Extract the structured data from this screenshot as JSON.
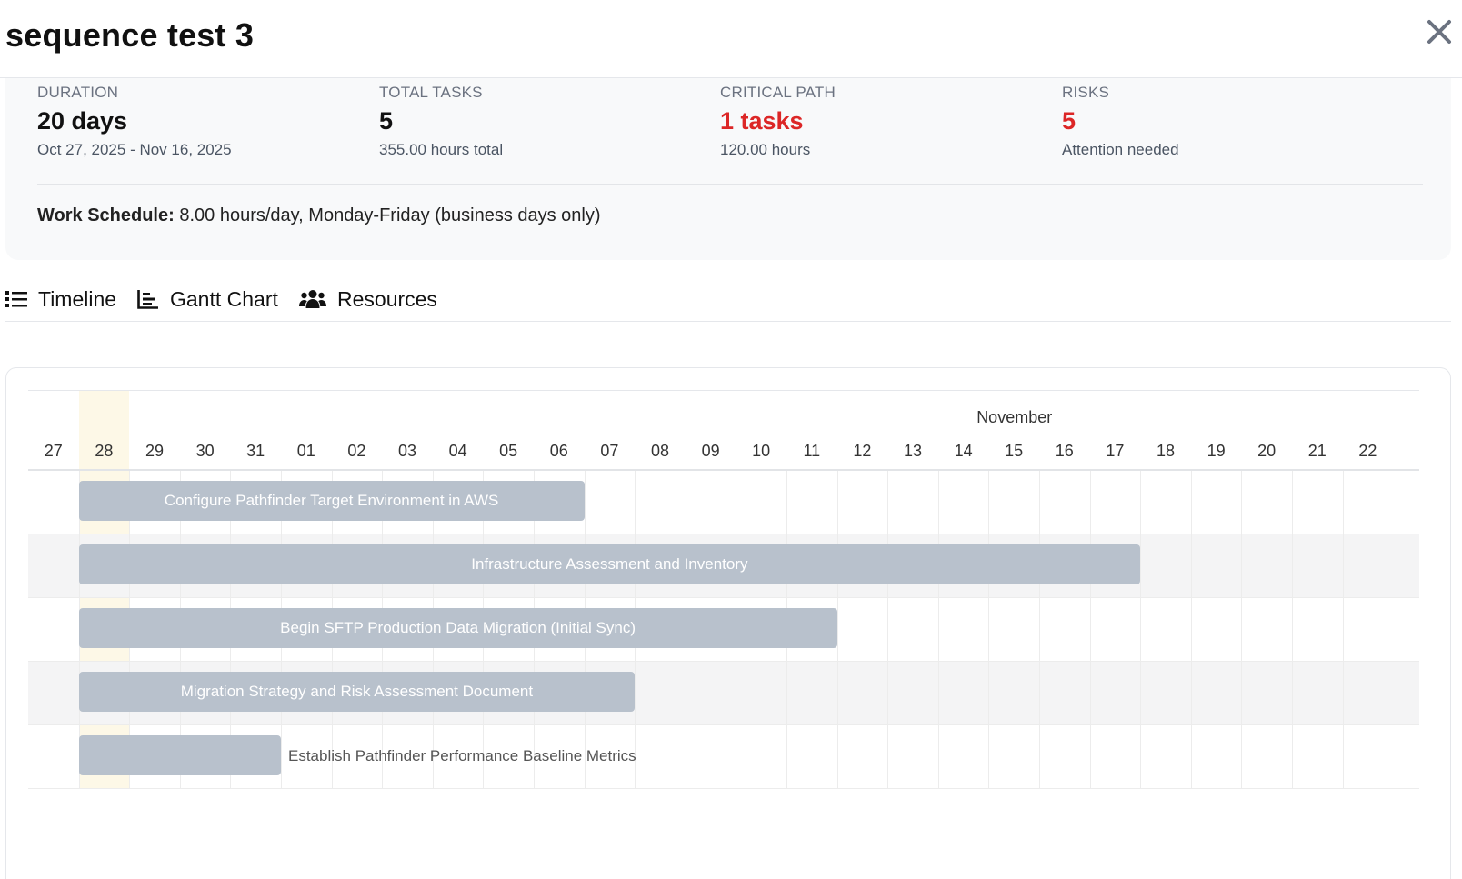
{
  "header": {
    "title": "sequence test 3",
    "close_icon": "close-icon"
  },
  "summary": {
    "duration": {
      "label": "DURATION",
      "value": "20 days",
      "sub": "Oct 27, 2025 - Nov 16, 2025"
    },
    "total_tasks": {
      "label": "TOTAL TASKS",
      "value": "5",
      "sub": "355.00 hours total"
    },
    "critical_path": {
      "label": "CRITICAL PATH",
      "value": "1 tasks",
      "sub": "120.00 hours"
    },
    "risks": {
      "label": "RISKS",
      "value": "5",
      "sub": "Attention needed"
    },
    "schedule_label": "Work Schedule:",
    "schedule_value": " 8.00 hours/day, Monday-Friday (business days only)",
    "alert_color": "#dc2626"
  },
  "tabs": [
    {
      "label": "Timeline",
      "icon": "list-icon"
    },
    {
      "label": "Gantt Chart",
      "icon": "chart-bar-icon"
    },
    {
      "label": "Resources",
      "icon": "users-icon"
    }
  ],
  "gantt": {
    "month_label": "November",
    "days": [
      "27",
      "28",
      "29",
      "30",
      "31",
      "01",
      "02",
      "03",
      "04",
      "05",
      "06",
      "07",
      "08",
      "09",
      "10",
      "11",
      "12",
      "13",
      "14",
      "15",
      "16",
      "17",
      "18",
      "19",
      "20",
      "21",
      "22"
    ],
    "today_index": 1,
    "tasks": [
      {
        "name": "Configure Pathfinder Target Environment in AWS",
        "start": 1,
        "end": 11,
        "label_inside": true
      },
      {
        "name": "Infrastructure Assessment and Inventory",
        "start": 1,
        "end": 22,
        "label_inside": true
      },
      {
        "name": "Begin SFTP Production Data Migration (Initial Sync)",
        "start": 1,
        "end": 16,
        "label_inside": true
      },
      {
        "name": "Migration Strategy and Risk Assessment Document",
        "start": 1,
        "end": 12,
        "label_inside": true
      },
      {
        "name": "Establish Pathfinder Performance Baseline Metrics",
        "start": 1,
        "end": 5,
        "label_inside": false
      }
    ],
    "bar_color": "#b8c1cc",
    "today_color": "#fdf8e7"
  }
}
